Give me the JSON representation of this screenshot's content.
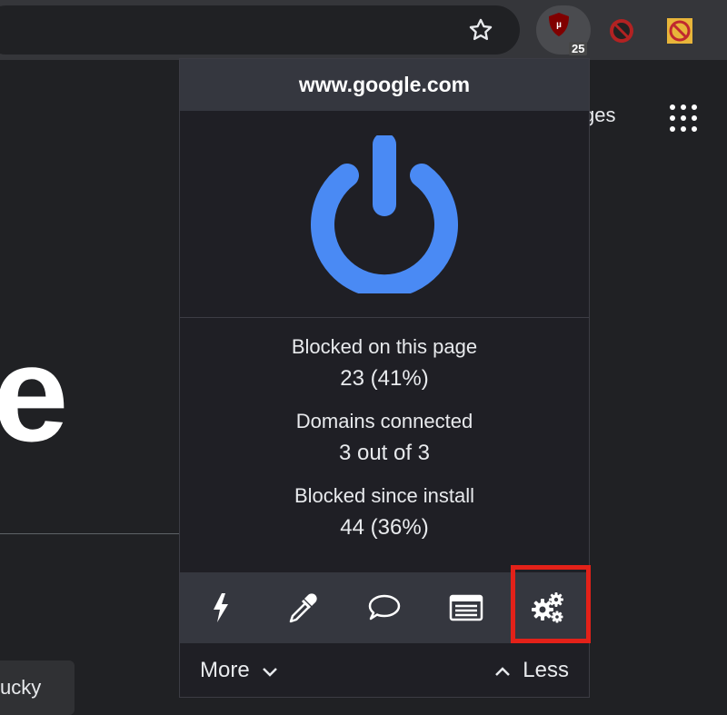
{
  "browser": {
    "extension_badge_count": "25",
    "icons": {
      "bookmark": "star-icon",
      "ublock": "ublock-shield-icon",
      "ext2": "adblock-icon",
      "ext3": "noscript-icon"
    }
  },
  "page": {
    "images_link_partial": "ges",
    "logo_partial": "e",
    "lucky_partial": "ucky"
  },
  "popup": {
    "hostname": "www.google.com",
    "power_state": "on",
    "power_color": "#4a8af4",
    "stats": [
      {
        "label": "Blocked on this page",
        "value": "23 (41%)"
      },
      {
        "label": "Domains connected",
        "value": "3 out of 3"
      },
      {
        "label": "Blocked since install",
        "value": "44 (36%)"
      }
    ],
    "tools": [
      "lightning-icon",
      "eyedropper-icon",
      "speech-bubble-icon",
      "logger-list-icon",
      "settings-gears-icon"
    ],
    "highlighted_tool": "settings-gears-icon",
    "highlight_color": "#e32119",
    "footer": {
      "more_label": "More",
      "less_label": "Less"
    }
  }
}
